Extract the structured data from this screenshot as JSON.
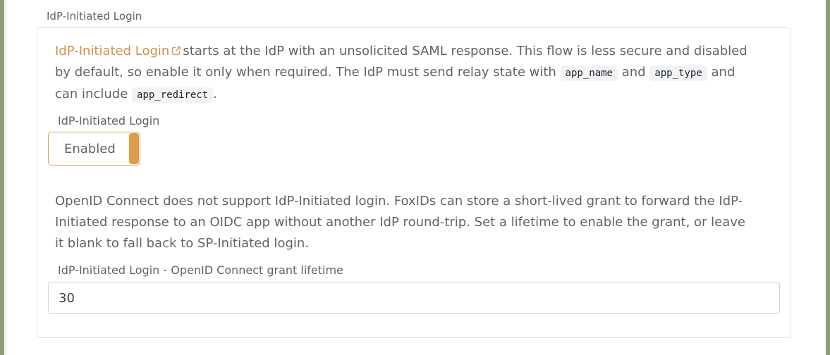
{
  "section": {
    "label": "IdP-Initiated Login"
  },
  "intro": {
    "link_text": "IdP-Initiated Login",
    "text_1": "starts at the IdP with an unsolicited SAML response. This flow is less secure and disabled by default, so enable it only when required. The IdP must send relay state with",
    "code_1": "app_name",
    "text_2": "and",
    "code_2": "app_type",
    "text_3": "and can include",
    "code_3": "app_redirect",
    "text_4": "."
  },
  "toggle_field": {
    "label": "IdP-Initiated Login",
    "value": "Enabled"
  },
  "oidc": {
    "description": "OpenID Connect does not support IdP-Initiated login. FoxIDs can store a short-lived grant to forward the IdP-Initiated response to an OIDC app without another IdP round-trip. Set a lifetime to enable the grant, or leave it blank to fall back to SP-Initiated login.",
    "field_label": "IdP-Initiated Login - OpenID Connect grant lifetime",
    "field_value": "30"
  },
  "colors": {
    "accent": "#dc9d4e",
    "link": "#d0914a",
    "frame": "#8d9b76",
    "text": "#606468"
  },
  "icons": {
    "external_link": "external-link-icon"
  }
}
